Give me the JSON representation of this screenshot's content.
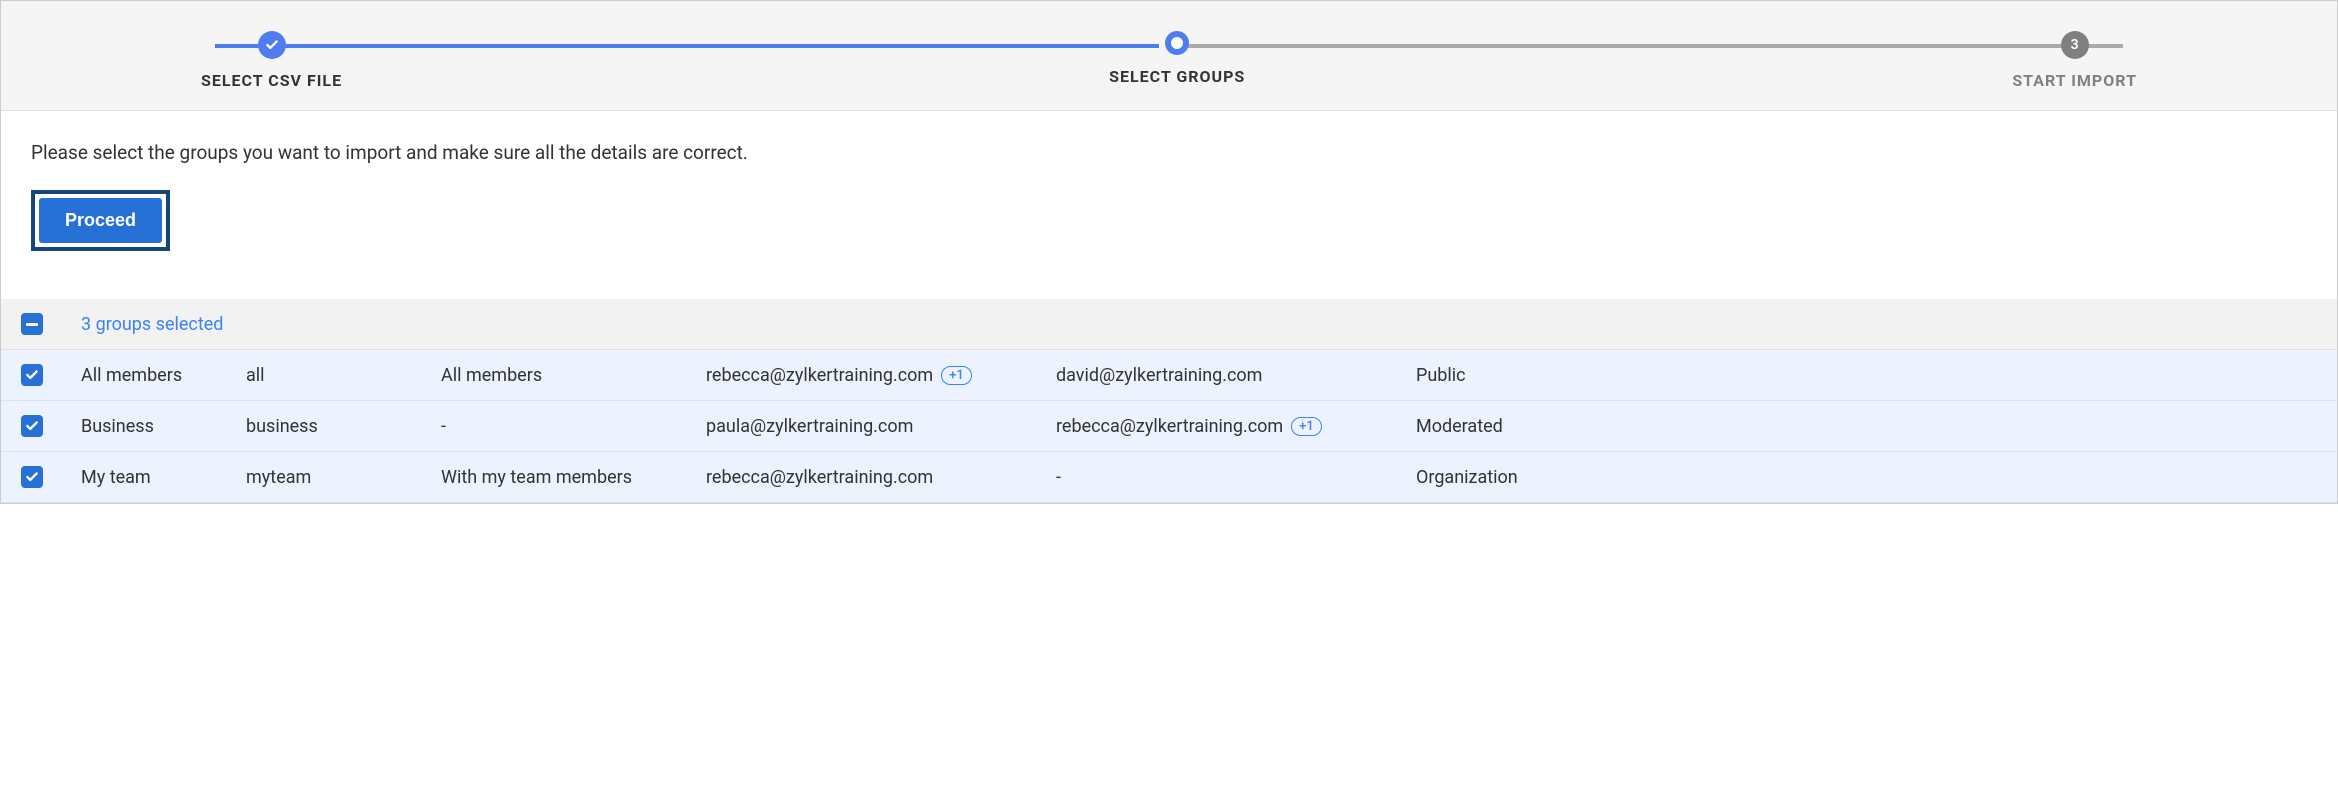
{
  "stepper": {
    "steps": [
      {
        "label": "SELECT CSV FILE",
        "state": "completed"
      },
      {
        "label": "SELECT GROUPS",
        "state": "active"
      },
      {
        "label": "START IMPORT",
        "state": "pending",
        "number": "3"
      }
    ]
  },
  "instruction": "Please select the groups you want to import and make sure all the details are correct.",
  "proceed_label": "Proceed",
  "selection_summary": "3 groups selected",
  "rows": [
    {
      "name": "All members",
      "alias": "all",
      "description": "All members",
      "email1": "rebecca@zylkertraining.com",
      "email1_extra": "+1",
      "email2": "david@zylkertraining.com",
      "email2_extra": "",
      "type": "Public"
    },
    {
      "name": "Business",
      "alias": "business",
      "description": "-",
      "email1": "paula@zylkertraining.com",
      "email1_extra": "",
      "email2": "rebecca@zylkertraining.com",
      "email2_extra": "+1",
      "type": "Moderated"
    },
    {
      "name": "My team",
      "alias": "myteam",
      "description": "With my team members",
      "email1": "rebecca@zylkertraining.com",
      "email1_extra": "",
      "email2": "-",
      "email2_extra": "",
      "type": "Organization"
    }
  ]
}
